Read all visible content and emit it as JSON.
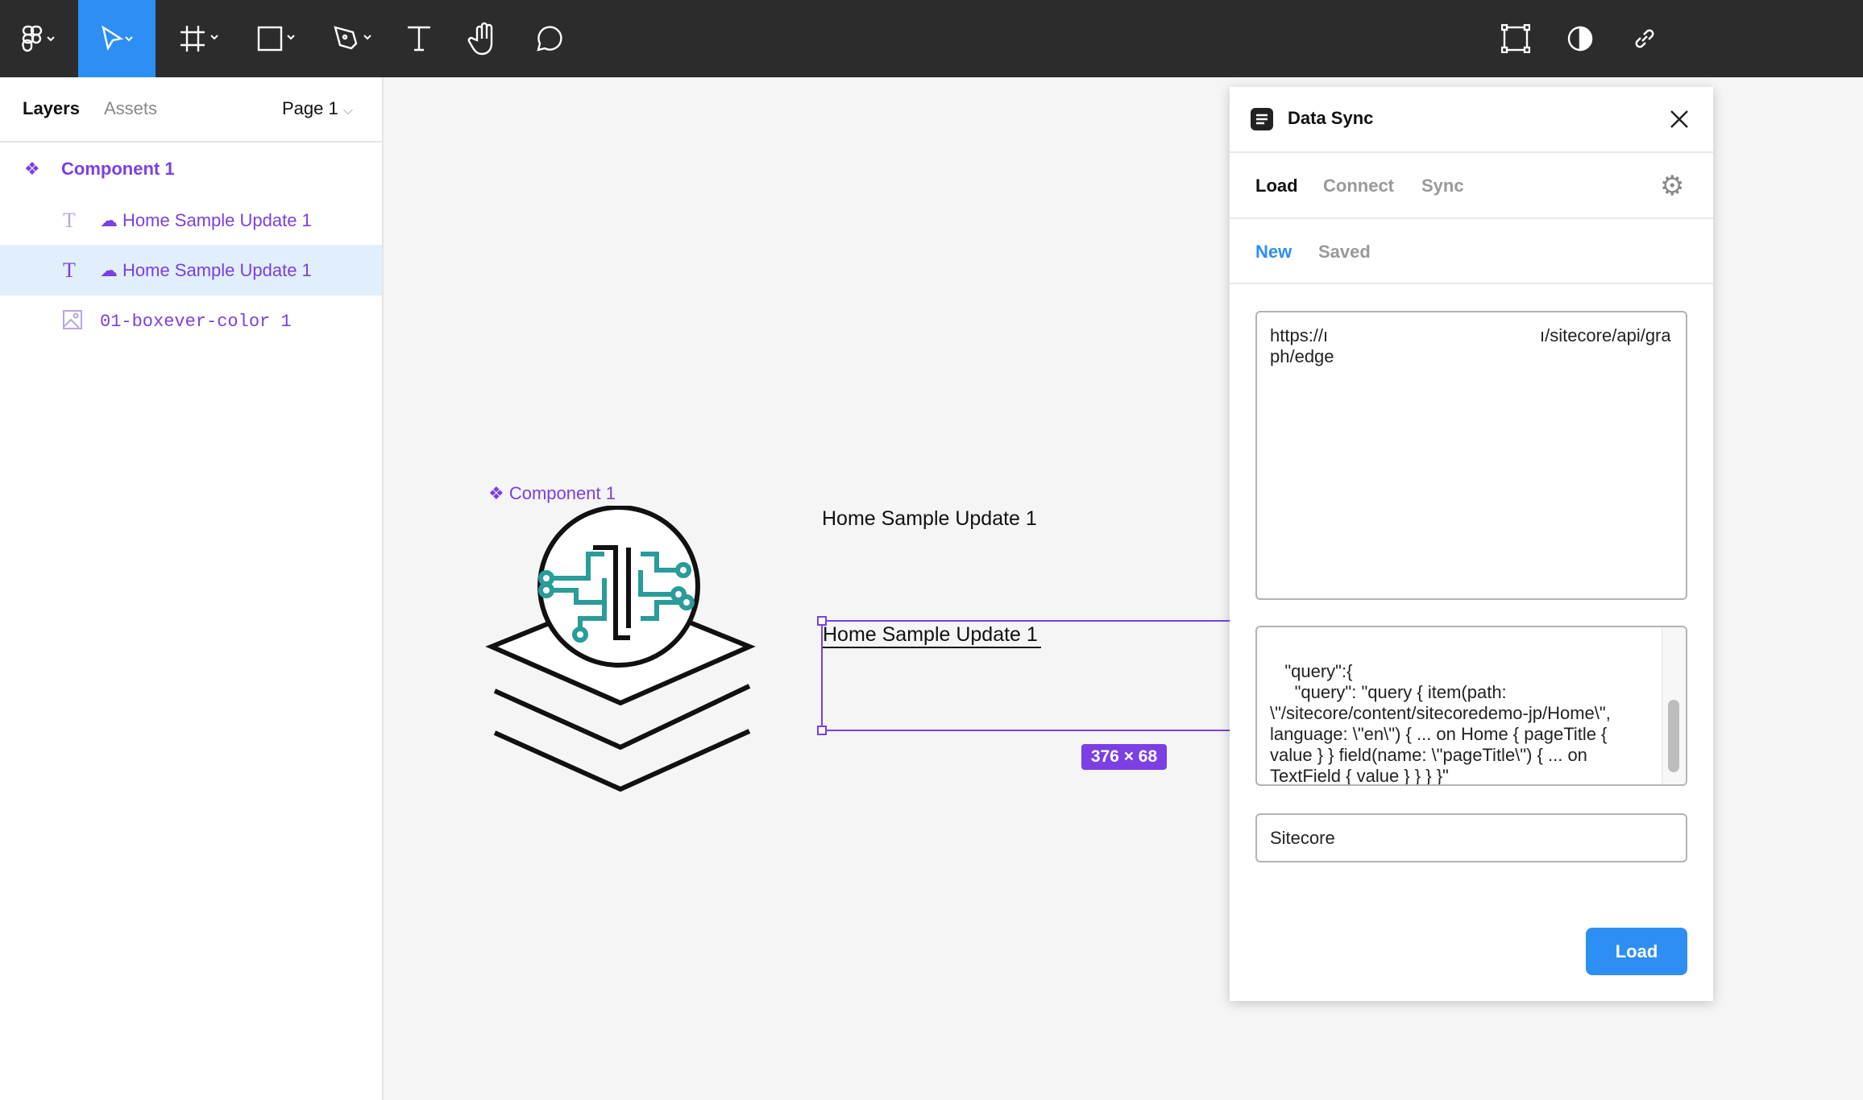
{
  "toolbar": {
    "tools": [
      "figma-menu",
      "move",
      "frame",
      "rectangle",
      "pen",
      "text",
      "hand",
      "comment"
    ],
    "active": "move",
    "right_icons": [
      "component-icon",
      "contrast-icon",
      "link-icon"
    ]
  },
  "left_panel": {
    "tabs": [
      "Layers",
      "Assets"
    ],
    "page": "Page 1",
    "layers": [
      {
        "name": "Component 1",
        "type": "component"
      },
      {
        "name": "Home Sample Update 1",
        "type": "text"
      },
      {
        "name": "Home Sample Update 1",
        "type": "text",
        "selected": true
      },
      {
        "name": "01-boxever-color 1",
        "type": "image"
      }
    ]
  },
  "canvas": {
    "component_label": "Component 1",
    "text1": "Home Sample Update 1",
    "text2": "Home Sample Update 1",
    "size_badge": "376 × 68"
  },
  "plugin": {
    "title": "Data Sync",
    "tabs": [
      "Load",
      "Connect",
      "Sync"
    ],
    "active_tab": "Load",
    "subtabs": [
      "New",
      "Saved"
    ],
    "active_subtab": "New",
    "endpoint": "https://ı                                           ı/sitecore/api/graph/edge",
    "query": "   \"query\":{\n     \"query\": \"query { item(path: \\\"/sitecore/content/sitecoredemo-jp/Home\\\", language: \\\"en\\\") { ... on Home { pageTitle { value } } field(name: \\\"pageTitle\\\") { ... on TextField { value } } } }\"\n   }\n}",
    "source": "Sitecore",
    "load_button": "Load"
  },
  "colors": {
    "accent": "#2d8ef3",
    "component": "#7b3fe4",
    "toolbar": "#2c2c2c"
  }
}
